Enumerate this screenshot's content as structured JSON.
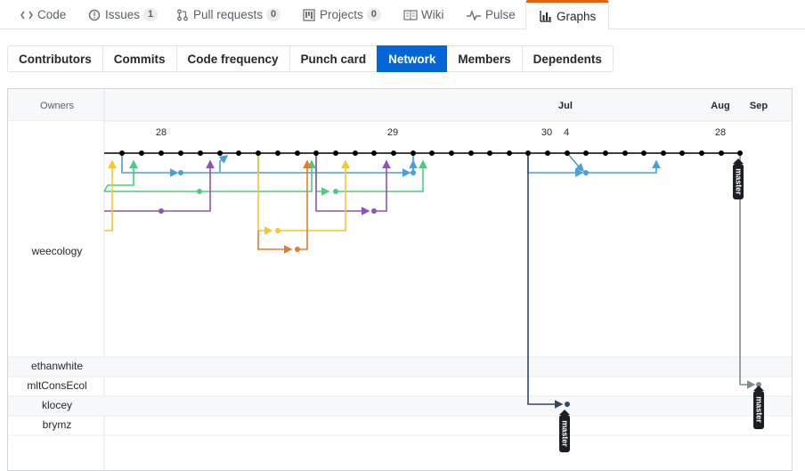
{
  "reponav": {
    "items": [
      {
        "label": "Code",
        "icon": "code-icon",
        "counter": null
      },
      {
        "label": "Issues",
        "icon": "issue-icon",
        "counter": "1"
      },
      {
        "label": "Pull requests",
        "icon": "pull-request-icon",
        "counter": "0"
      },
      {
        "label": "Projects",
        "icon": "project-icon",
        "counter": "0"
      },
      {
        "label": "Wiki",
        "icon": "book-icon",
        "counter": null
      },
      {
        "label": "Pulse",
        "icon": "pulse-icon",
        "counter": null
      },
      {
        "label": "Graphs",
        "icon": "graph-icon",
        "counter": null,
        "selected": true
      }
    ]
  },
  "subnav": {
    "items": [
      {
        "label": "Contributors"
      },
      {
        "label": "Commits"
      },
      {
        "label": "Code frequency"
      },
      {
        "label": "Punch card"
      },
      {
        "label": "Network",
        "selected": true
      },
      {
        "label": "Members"
      },
      {
        "label": "Dependents"
      }
    ]
  },
  "network": {
    "owners_header": "Owners",
    "months": [
      "Jul",
      "Aug",
      "Sep"
    ],
    "days": [
      "28",
      "29",
      "30",
      "4",
      "28"
    ],
    "owners": [
      "weecology",
      "ethanwhite",
      "mltConsEcol",
      "klocey",
      "brymz"
    ],
    "branch_labels": [
      "master",
      "master",
      "master"
    ],
    "colors": {
      "mainline": "#000000",
      "blue": "#4a9fd8",
      "green": "#4ecb7c",
      "purple": "#8e52b9",
      "yellow": "#f5c62f",
      "orange": "#e27d2a",
      "navy": "#34495e",
      "gray": "#7f8c8d",
      "accent": "#0366d6",
      "tab_underline": "#e36209"
    }
  }
}
